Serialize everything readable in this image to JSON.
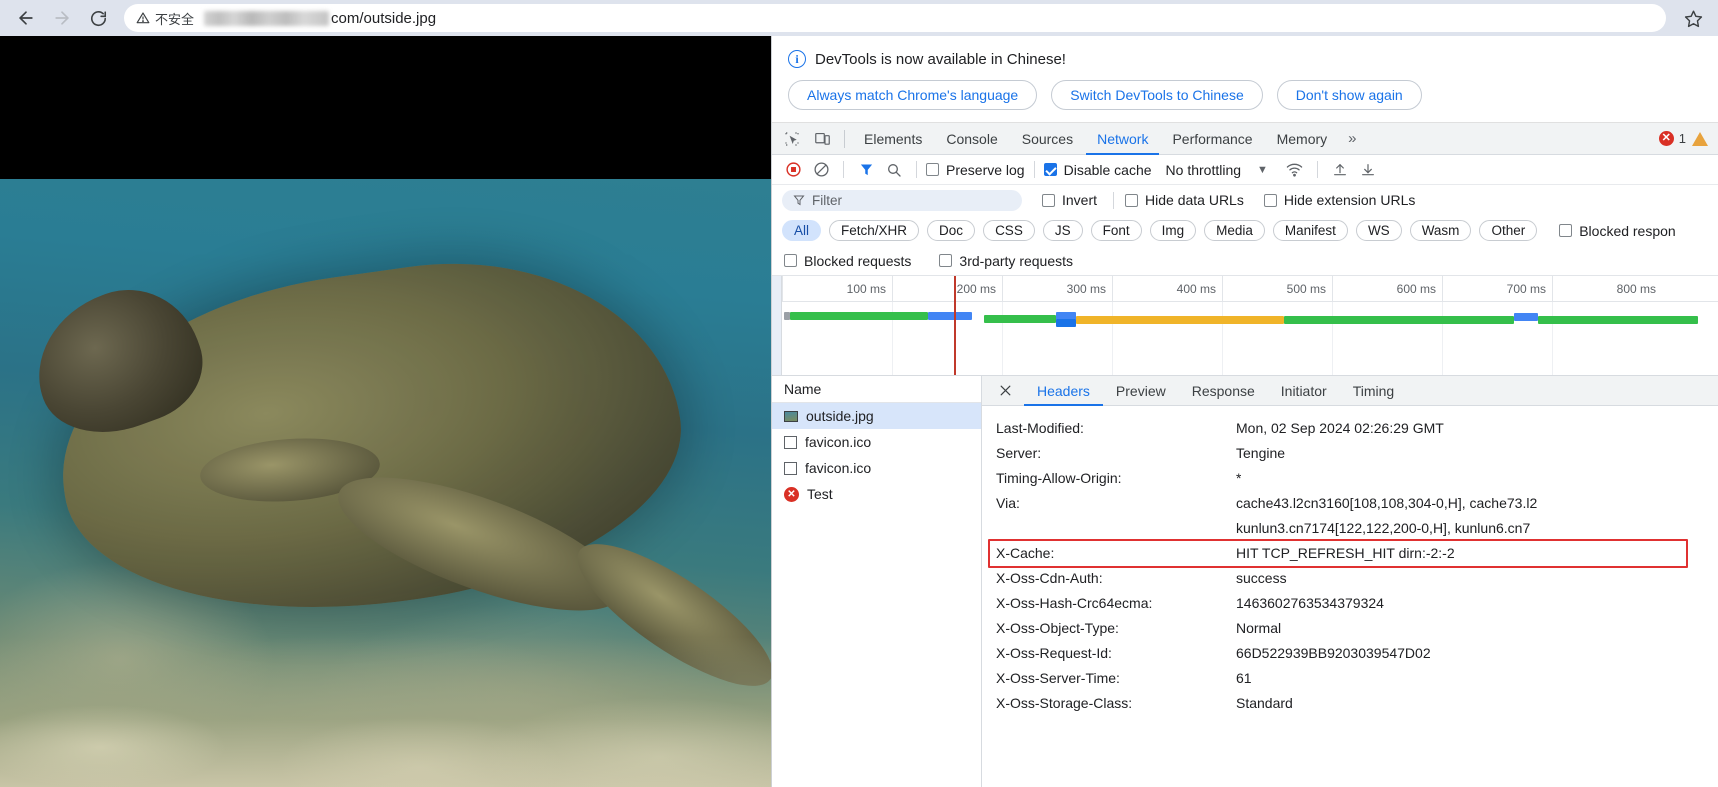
{
  "browser": {
    "back_icon": "back-arrow-icon",
    "forward_icon": "forward-arrow-icon",
    "reload_icon": "reload-icon",
    "security_label": "不安全",
    "url_text": "com/outside.jpg",
    "star_icon": "bookmark-star-icon"
  },
  "devtools": {
    "notification": {
      "message": "DevTools is now available in Chinese!",
      "buttons": [
        "Always match Chrome's language",
        "Switch DevTools to Chinese",
        "Don't show again"
      ]
    },
    "tabs": [
      {
        "label": "Elements",
        "active": false
      },
      {
        "label": "Console",
        "active": false
      },
      {
        "label": "Sources",
        "active": false
      },
      {
        "label": "Network",
        "active": true
      },
      {
        "label": "Performance",
        "active": false
      },
      {
        "label": "Memory",
        "active": false
      }
    ],
    "tab_overflow": "»",
    "error_count": "1",
    "toolbar": {
      "record_icon": "record-stop-icon",
      "clear_icon": "clear-icon",
      "filter_icon": "filter-icon",
      "search_icon": "search-icon",
      "preserve_log": {
        "label": "Preserve log",
        "checked": false
      },
      "disable_cache": {
        "label": "Disable cache",
        "checked": true
      },
      "throttling": "No throttling",
      "wifi_icon": "network-conditions-icon",
      "import_icon": "import-har-icon",
      "export_icon": "export-har-icon"
    },
    "filter": {
      "placeholder": "Filter",
      "invert": {
        "label": "Invert",
        "checked": false
      },
      "hide_data_urls": {
        "label": "Hide data URLs",
        "checked": false
      },
      "hide_extension_urls": {
        "label": "Hide extension URLs",
        "checked": false
      }
    },
    "resource_types": [
      {
        "label": "All",
        "active": true
      },
      {
        "label": "Fetch/XHR",
        "active": false
      },
      {
        "label": "Doc",
        "active": false
      },
      {
        "label": "CSS",
        "active": false
      },
      {
        "label": "JS",
        "active": false
      },
      {
        "label": "Font",
        "active": false
      },
      {
        "label": "Img",
        "active": false
      },
      {
        "label": "Media",
        "active": false
      },
      {
        "label": "Manifest",
        "active": false
      },
      {
        "label": "WS",
        "active": false
      },
      {
        "label": "Wasm",
        "active": false
      },
      {
        "label": "Other",
        "active": false
      }
    ],
    "blocked_responses": {
      "label": "Blocked respon",
      "checked": false
    },
    "blocked_requests": {
      "label": "Blocked requests",
      "checked": false
    },
    "third_party_requests": {
      "label": "3rd-party requests",
      "checked": false
    },
    "timeline": {
      "ticks": [
        "100 ms",
        "200 ms",
        "300 ms",
        "400 ms",
        "500 ms",
        "600 ms",
        "700 ms",
        "800 ms"
      ],
      "marker_ms": 212
    },
    "requests": {
      "column_header": "Name",
      "rows": [
        {
          "name": "outside.jpg",
          "icon": "image-thumbnail-icon",
          "selected": true
        },
        {
          "name": "favicon.ico",
          "icon": "generic-file-icon",
          "selected": false
        },
        {
          "name": "favicon.ico",
          "icon": "generic-file-icon",
          "selected": false
        },
        {
          "name": "Test",
          "icon": "error-icon",
          "selected": false
        }
      ]
    },
    "detail_tabs": [
      {
        "label": "Headers",
        "active": true
      },
      {
        "label": "Preview",
        "active": false
      },
      {
        "label": "Response",
        "active": false
      },
      {
        "label": "Initiator",
        "active": false
      },
      {
        "label": "Timing",
        "active": false
      }
    ],
    "close_icon": "close-icon",
    "headers": [
      {
        "name": "Last-Modified:",
        "value": "Mon, 02 Sep 2024 02:26:29 GMT",
        "highlighted": false
      },
      {
        "name": "Server:",
        "value": "Tengine",
        "highlighted": false
      },
      {
        "name": "Timing-Allow-Origin:",
        "value": "*",
        "highlighted": false
      },
      {
        "name": "Via:",
        "value": "cache43.l2cn3160[108,108,304-0,H], cache73.l2",
        "continuation": "kunlun3.cn7174[122,122,200-0,H], kunlun6.cn7",
        "highlighted": false
      },
      {
        "name": "X-Cache:",
        "value": "HIT TCP_REFRESH_HIT dirn:-2:-2",
        "highlighted": true
      },
      {
        "name": "X-Oss-Cdn-Auth:",
        "value": "success",
        "highlighted": false
      },
      {
        "name": "X-Oss-Hash-Crc64ecma:",
        "value": "1463602763534379324",
        "highlighted": false
      },
      {
        "name": "X-Oss-Object-Type:",
        "value": "Normal",
        "highlighted": false
      },
      {
        "name": "X-Oss-Request-Id:",
        "value": "66D522939BB9203039547D02",
        "highlighted": false
      },
      {
        "name": "X-Oss-Server-Time:",
        "value": "61",
        "highlighted": false
      },
      {
        "name": "X-Oss-Storage-Class:",
        "value": "Standard",
        "highlighted": false
      }
    ],
    "colors": {
      "accent": "#1a73e8",
      "error": "#d93025",
      "warning": "#e8a33d",
      "highlight_box": "#e03131"
    }
  }
}
